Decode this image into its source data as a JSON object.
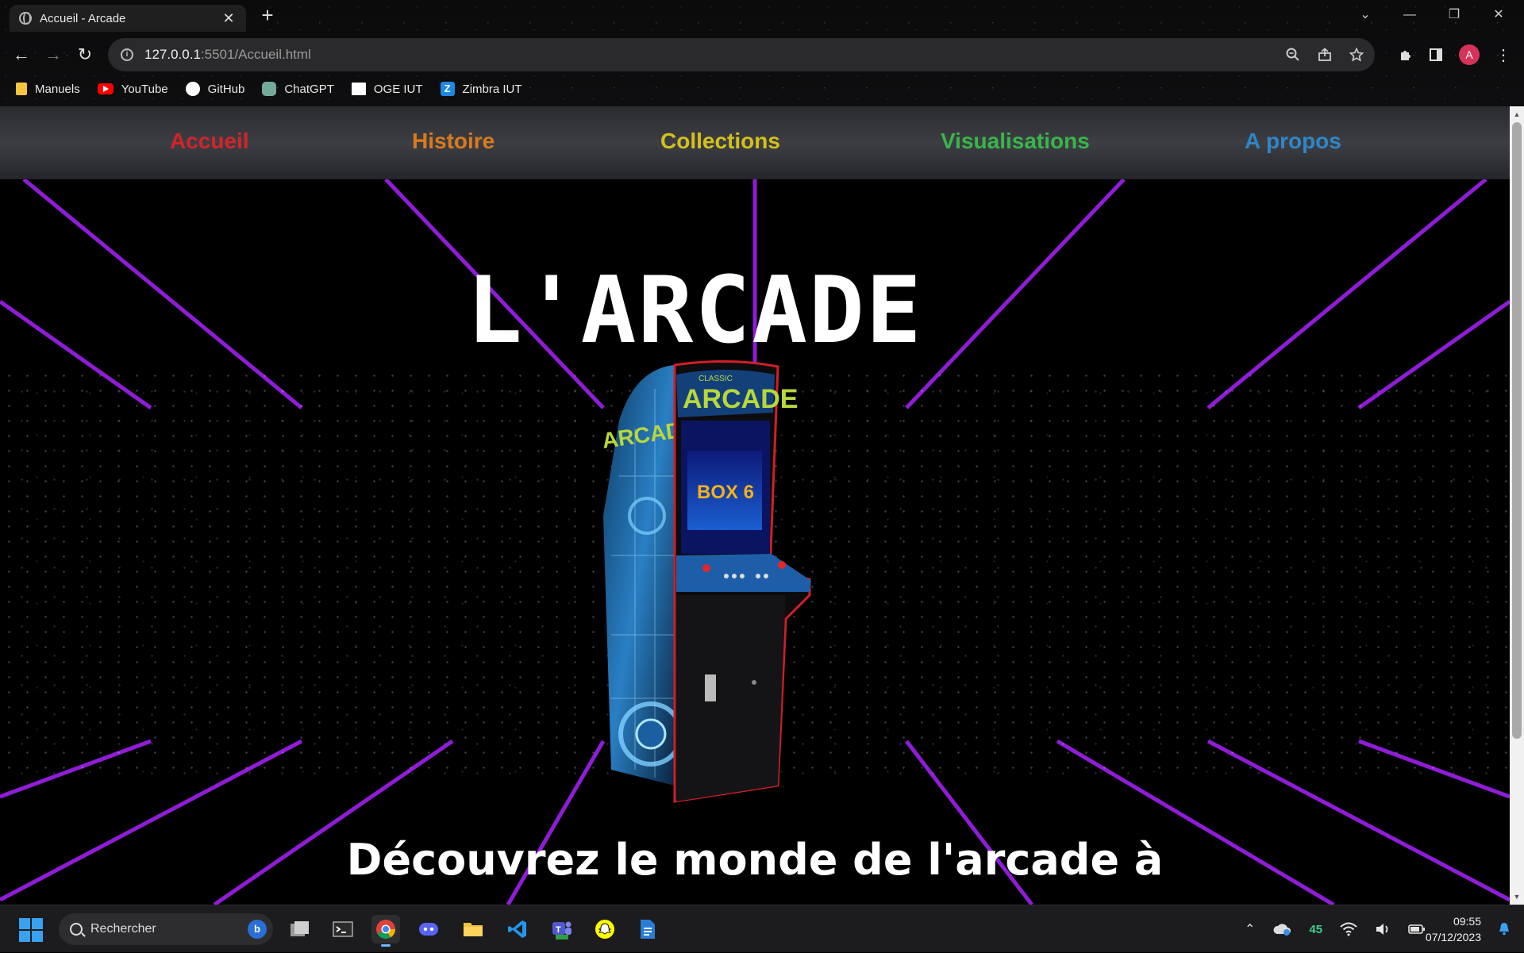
{
  "browser": {
    "tab_title": "Accueil - Arcade",
    "new_tab_label": "+",
    "url_host": "127.0.0.1",
    "url_path": ":5501/Accueil.html",
    "profile_initial": "A",
    "bookmarks": [
      {
        "label": "Manuels",
        "icon_color": "#f5c542",
        "icon": "folder-icon"
      },
      {
        "label": "YouTube",
        "icon_color": "#ff0000",
        "icon": "youtube-icon"
      },
      {
        "label": "GitHub",
        "icon_color": "#ffffff",
        "icon": "github-icon"
      },
      {
        "label": "ChatGPT",
        "icon_color": "#74aa9c",
        "icon": "chatgpt-icon"
      },
      {
        "label": "OGE IUT",
        "icon_color": "#ffffff",
        "icon": "oge-icon"
      },
      {
        "label": "Zimbra IUT",
        "icon_color": "#1e88e5",
        "icon": "zimbra-icon"
      }
    ]
  },
  "site": {
    "nav": {
      "accueil": "Accueil",
      "histoire": "Histoire",
      "collections": "Collections",
      "visualisations": "Visualisations",
      "apropos": "A propos"
    },
    "title": "L'ARCADE",
    "subtitle": "Découvrez le monde de l'arcade à",
    "cabinet": {
      "marquee": "ARCADE",
      "marquee_small": "CLASSIC",
      "side_text": "ARCADE",
      "screen_text": "BOX 6",
      "colors": {
        "accent": "#d01f27",
        "side_blue": "#2a7fc4",
        "marquee_green": "#b6d83a"
      }
    },
    "colors": {
      "grid": "#8a1fd6",
      "nav_accueil": "#d2252a",
      "nav_histoire": "#d97a1e",
      "nav_collections": "#d3c11b",
      "nav_visu": "#39b54a",
      "nav_apropos": "#2f86c8"
    }
  },
  "taskbar": {
    "search_placeholder": "Rechercher",
    "tray_badge": "45",
    "time": "09:55",
    "date": "07/12/2023"
  }
}
